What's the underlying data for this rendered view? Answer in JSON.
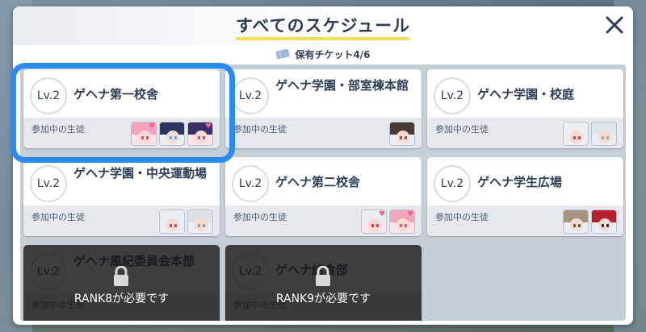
{
  "title": "すべてのスケジュール",
  "ticket": {
    "label": "保有チケット4/6"
  },
  "cards": [
    {
      "level": "Lv.2",
      "name": "ゲヘナ第一校舎",
      "subtitle": "参加中の生徒",
      "locked": false,
      "avatars": [
        {
          "hair": "#f5a3b8",
          "eye": "#e0457a",
          "heart": true
        },
        {
          "hair": "#2c3560",
          "eye": "#6aa0e8",
          "heart": false
        },
        {
          "hair": "#3b2e6b",
          "eye": "#c24a8a",
          "heart": true
        }
      ]
    },
    {
      "level": "Lv.2",
      "name": "ゲヘナ学園・部室棟本館",
      "subtitle": "参加中の生徒",
      "locked": false,
      "avatars": [
        {
          "hair": "#4a3a34",
          "eye": "#c33b3b",
          "heart": false
        }
      ]
    },
    {
      "level": "Lv.2",
      "name": "ゲヘナ学園・校庭",
      "subtitle": "参加中の生徒",
      "locked": false,
      "avatars": [
        {
          "hair": "#eceef2",
          "eye": "#d23f5e",
          "heart": false
        },
        {
          "hair": "#dfe6ea",
          "eye": "#7fb0c8",
          "heart": false
        }
      ]
    },
    {
      "level": "Lv.2",
      "name": "ゲヘナ学園・中央運動場",
      "subtitle": "参加中の生徒",
      "locked": false,
      "avatars": [
        {
          "hair": "#e6eef2",
          "eye": "#b14f6e",
          "heart": false
        },
        {
          "hair": "#dde2e6",
          "eye": "#8a9aa6",
          "heart": false
        }
      ]
    },
    {
      "level": "Lv.2",
      "name": "ゲヘナ第二校舎",
      "subtitle": "参加中の生徒",
      "locked": false,
      "avatars": [
        {
          "hair": "#e9ecf0",
          "eye": "#c8385e",
          "heart": true
        },
        {
          "hair": "#f2a6bd",
          "eye": "#d84b7d",
          "heart": true
        }
      ]
    },
    {
      "level": "Lv.2",
      "name": "ゲヘナ学生広場",
      "subtitle": "参加中の生徒",
      "locked": false,
      "avatars": [
        {
          "hair": "#a89480",
          "eye": "#6b4d3a",
          "heart": false
        },
        {
          "hair": "#b8202e",
          "eye": "#2a2a2a",
          "heart": false
        }
      ]
    },
    {
      "level": "Lv.2",
      "name": "ゲヘナ風紀委員会本部",
      "subtitle": "参加中の生徒",
      "locked": true,
      "lock_text": "RANK8が必要です"
    },
    {
      "level": "Lv.2",
      "name": "ゲヘナ給食部",
      "subtitle": "参加中の生徒",
      "locked": true,
      "lock_text": "RANK9が必要です"
    }
  ],
  "colors": {
    "selected": "#2a8bf2",
    "title_underline": "#f2de5a",
    "heart": "#ff5d8f"
  },
  "icons": {
    "close": "close-icon",
    "ticket": "ticket-icon",
    "lock": "lock-icon",
    "heart": "heart-icon"
  }
}
